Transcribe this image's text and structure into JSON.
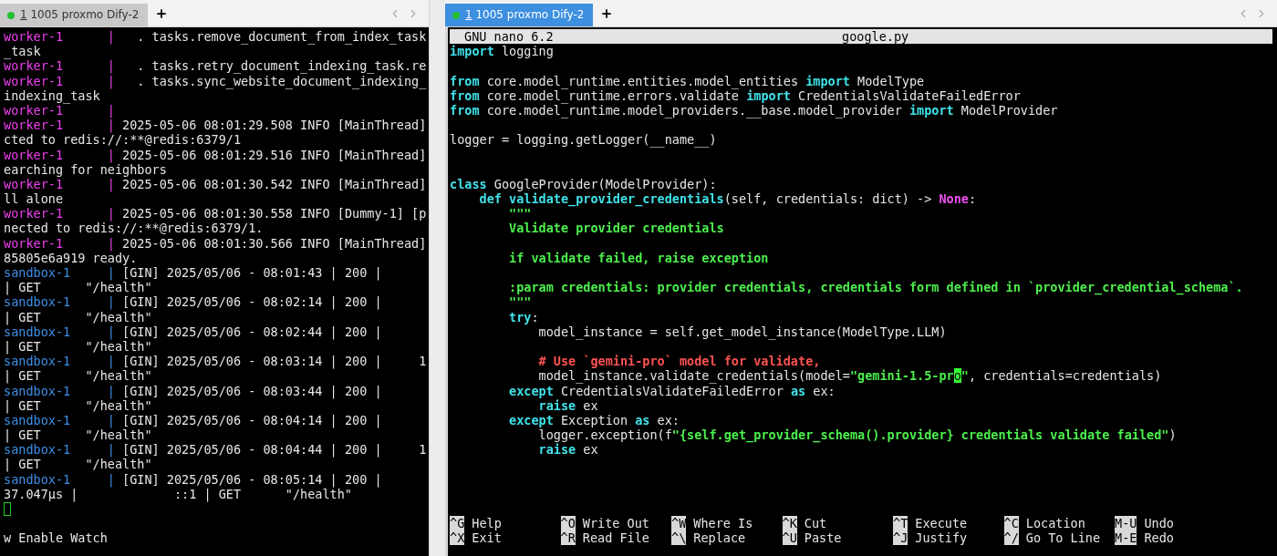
{
  "left_terminal": {
    "tab": {
      "index": "1",
      "label": "1005 proxmo Dify-2",
      "selected": false
    },
    "lines": [
      {
        "kind": "text",
        "segments": [
          {
            "kind": "worker",
            "text": "worker-1      |"
          },
          {
            "kind": "plain",
            "text": "   . tasks.remove_document_from_index_task"
          }
        ]
      },
      {
        "kind": "text",
        "segments": [
          {
            "kind": "plain",
            "text": "_task"
          }
        ]
      },
      {
        "kind": "text",
        "segments": [
          {
            "kind": "worker",
            "text": "worker-1      |"
          },
          {
            "kind": "plain",
            "text": "   . tasks.retry_document_indexing_task.re"
          }
        ]
      },
      {
        "kind": "text",
        "segments": [
          {
            "kind": "worker",
            "text": "worker-1      |"
          },
          {
            "kind": "plain",
            "text": "   . tasks.sync_website_document_indexing_"
          }
        ]
      },
      {
        "kind": "text",
        "segments": [
          {
            "kind": "plain",
            "text": "indexing_task"
          }
        ]
      },
      {
        "kind": "text",
        "segments": [
          {
            "kind": "worker",
            "text": "worker-1      |"
          }
        ]
      },
      {
        "kind": "text",
        "segments": [
          {
            "kind": "worker",
            "text": "worker-1      |"
          },
          {
            "kind": "plain",
            "text": " 2025-05-06 08:01:29.508 INFO [MainThread]"
          }
        ]
      },
      {
        "kind": "text",
        "segments": [
          {
            "kind": "plain",
            "text": "cted to redis://:**@redis:6379/1"
          }
        ]
      },
      {
        "kind": "text",
        "segments": [
          {
            "kind": "worker",
            "text": "worker-1      |"
          },
          {
            "kind": "plain",
            "text": " 2025-05-06 08:01:29.516 INFO [MainThread]"
          }
        ]
      },
      {
        "kind": "text",
        "segments": [
          {
            "kind": "plain",
            "text": "earching for neighbors"
          }
        ]
      },
      {
        "kind": "text",
        "segments": [
          {
            "kind": "worker",
            "text": "worker-1      |"
          },
          {
            "kind": "plain",
            "text": " 2025-05-06 08:01:30.542 INFO [MainThread]"
          }
        ]
      },
      {
        "kind": "text",
        "segments": [
          {
            "kind": "plain",
            "text": "ll alone"
          }
        ]
      },
      {
        "kind": "text",
        "segments": [
          {
            "kind": "worker",
            "text": "worker-1      |"
          },
          {
            "kind": "plain",
            "text": " 2025-05-06 08:01:30.558 INFO [Dummy-1] [p"
          }
        ]
      },
      {
        "kind": "text",
        "segments": [
          {
            "kind": "plain",
            "text": "nected to redis://:**@redis:6379/1."
          }
        ]
      },
      {
        "kind": "text",
        "segments": [
          {
            "kind": "worker",
            "text": "worker-1      |"
          },
          {
            "kind": "plain",
            "text": " 2025-05-06 08:01:30.566 INFO [MainThread]"
          }
        ]
      },
      {
        "kind": "text",
        "segments": [
          {
            "kind": "plain",
            "text": "85805e6a919 ready."
          }
        ]
      },
      {
        "kind": "text",
        "segments": [
          {
            "kind": "sandbox",
            "text": "sandbox-1     |"
          },
          {
            "kind": "plain",
            "text": " [GIN] 2025/05/06 - 08:01:43 | 200 |"
          }
        ]
      },
      {
        "kind": "text",
        "segments": [
          {
            "kind": "plain",
            "text": "| GET      \"/health\""
          }
        ]
      },
      {
        "kind": "text",
        "segments": [
          {
            "kind": "sandbox",
            "text": "sandbox-1     |"
          },
          {
            "kind": "plain",
            "text": " [GIN] 2025/05/06 - 08:02:14 | 200 |"
          }
        ]
      },
      {
        "kind": "text",
        "segments": [
          {
            "kind": "plain",
            "text": "| GET      \"/health\""
          }
        ]
      },
      {
        "kind": "text",
        "segments": [
          {
            "kind": "sandbox",
            "text": "sandbox-1     |"
          },
          {
            "kind": "plain",
            "text": " [GIN] 2025/05/06 - 08:02:44 | 200 |"
          }
        ]
      },
      {
        "kind": "text",
        "segments": [
          {
            "kind": "plain",
            "text": "| GET      \"/health\""
          }
        ]
      },
      {
        "kind": "text",
        "segments": [
          {
            "kind": "sandbox",
            "text": "sandbox-1     |"
          },
          {
            "kind": "plain",
            "text": " [GIN] 2025/05/06 - 08:03:14 | 200 |     1"
          }
        ]
      },
      {
        "kind": "text",
        "segments": [
          {
            "kind": "plain",
            "text": "| GET      \"/health\""
          }
        ]
      },
      {
        "kind": "text",
        "segments": [
          {
            "kind": "sandbox",
            "text": "sandbox-1     |"
          },
          {
            "kind": "plain",
            "text": " [GIN] 2025/05/06 - 08:03:44 | 200 |"
          }
        ]
      },
      {
        "kind": "text",
        "segments": [
          {
            "kind": "plain",
            "text": "| GET      \"/health\""
          }
        ]
      },
      {
        "kind": "text",
        "segments": [
          {
            "kind": "sandbox",
            "text": "sandbox-1     |"
          },
          {
            "kind": "plain",
            "text": " [GIN] 2025/05/06 - 08:04:14 | 200 |"
          }
        ]
      },
      {
        "kind": "text",
        "segments": [
          {
            "kind": "plain",
            "text": "| GET      \"/health\""
          }
        ]
      },
      {
        "kind": "text",
        "segments": [
          {
            "kind": "sandbox",
            "text": "sandbox-1     |"
          },
          {
            "kind": "plain",
            "text": " [GIN] 2025/05/06 - 08:04:44 | 200 |     1"
          }
        ]
      },
      {
        "kind": "text",
        "segments": [
          {
            "kind": "plain",
            "text": "| GET      \"/health\""
          }
        ]
      },
      {
        "kind": "text",
        "segments": [
          {
            "kind": "sandbox",
            "text": "sandbox-1     |"
          },
          {
            "kind": "plain",
            "text": " [GIN] 2025/05/06 - 08:05:14 | 200 |"
          }
        ]
      },
      {
        "kind": "text",
        "segments": [
          {
            "kind": "plain",
            "text": "37.047µs |             ::1 | GET      \"/health\""
          }
        ]
      },
      {
        "kind": "cursor"
      },
      {
        "kind": "blank"
      },
      {
        "kind": "text",
        "segments": [
          {
            "kind": "plain",
            "text": "w Enable Watch"
          }
        ]
      }
    ]
  },
  "right_terminal": {
    "tab": {
      "index": "1",
      "label": "1005 proxmo Dify-2",
      "selected": true
    },
    "nano_title": {
      "version": "GNU nano 6.2",
      "file": "google.py"
    },
    "code_lines": [
      {
        "kind": "text",
        "segments": [
          {
            "kind": "keyword",
            "text": "import"
          },
          {
            "kind": "plain",
            "text": " logging"
          }
        ]
      },
      {
        "kind": "blank"
      },
      {
        "kind": "text",
        "segments": [
          {
            "kind": "keyword",
            "text": "from"
          },
          {
            "kind": "plain",
            "text": " core.model_runtime.entities.model_entities "
          },
          {
            "kind": "keyword",
            "text": "import"
          },
          {
            "kind": "plain",
            "text": " ModelType"
          }
        ]
      },
      {
        "kind": "text",
        "segments": [
          {
            "kind": "keyword",
            "text": "from"
          },
          {
            "kind": "plain",
            "text": " core.model_runtime.errors.validate "
          },
          {
            "kind": "keyword",
            "text": "import"
          },
          {
            "kind": "plain",
            "text": " CredentialsValidateFailedError"
          }
        ]
      },
      {
        "kind": "text",
        "segments": [
          {
            "kind": "keyword",
            "text": "from"
          },
          {
            "kind": "plain",
            "text": " core.model_runtime.model_providers.__base.model_provider "
          },
          {
            "kind": "keyword",
            "text": "import"
          },
          {
            "kind": "plain",
            "text": " ModelProvider"
          }
        ]
      },
      {
        "kind": "blank"
      },
      {
        "kind": "text",
        "segments": [
          {
            "kind": "plain",
            "text": "logger = logging.getLogger(__name__)"
          }
        ]
      },
      {
        "kind": "blank"
      },
      {
        "kind": "blank"
      },
      {
        "kind": "text",
        "segments": [
          {
            "kind": "keyword",
            "text": "class"
          },
          {
            "kind": "plain",
            "text": " GoogleProvider(ModelProvider):"
          }
        ]
      },
      {
        "kind": "text",
        "segments": [
          {
            "kind": "keyword",
            "text": "    def validate_provider_credentials"
          },
          {
            "kind": "plain",
            "text": "(self, credentials: dict) -> "
          },
          {
            "kind": "constant",
            "text": "None"
          },
          {
            "kind": "plain",
            "text": ":"
          }
        ]
      },
      {
        "kind": "text",
        "segments": [
          {
            "kind": "string",
            "text": "        \"\"\""
          }
        ]
      },
      {
        "kind": "text",
        "segments": [
          {
            "kind": "string",
            "text": "        Validate provider credentials"
          }
        ]
      },
      {
        "kind": "blank"
      },
      {
        "kind": "text",
        "segments": [
          {
            "kind": "string",
            "text": "        if validate failed, raise exception"
          }
        ]
      },
      {
        "kind": "blank"
      },
      {
        "kind": "text",
        "segments": [
          {
            "kind": "string",
            "text": "        :param credentials: provider credentials, credentials form defined in `provider_credential_schema`."
          }
        ]
      },
      {
        "kind": "text",
        "segments": [
          {
            "kind": "string",
            "text": "        \"\"\""
          }
        ]
      },
      {
        "kind": "text",
        "segments": [
          {
            "kind": "keyword",
            "text": "        try"
          },
          {
            "kind": "plain",
            "text": ":"
          }
        ]
      },
      {
        "kind": "text",
        "segments": [
          {
            "kind": "plain",
            "text": "            model_instance = self.get_model_instance(ModelType.LLM)"
          }
        ]
      },
      {
        "kind": "blank"
      },
      {
        "kind": "text",
        "segments": [
          {
            "kind": "comment",
            "text": "            # Use `gemini-pro` model for validate,"
          }
        ]
      },
      {
        "kind": "text",
        "segments": [
          {
            "kind": "plain",
            "text": "            model_instance.validate_credentials(model="
          },
          {
            "kind": "string",
            "text": "\"gemini-1.5-pr"
          },
          {
            "kind": "cursor",
            "text": "o"
          },
          {
            "kind": "string",
            "text": "\""
          },
          {
            "kind": "plain",
            "text": ", credentials=credentials)"
          }
        ]
      },
      {
        "kind": "text",
        "segments": [
          {
            "kind": "keyword",
            "text": "        except"
          },
          {
            "kind": "plain",
            "text": " CredentialsValidateFailedError "
          },
          {
            "kind": "keyword",
            "text": "as"
          },
          {
            "kind": "plain",
            "text": " ex:"
          }
        ]
      },
      {
        "kind": "text",
        "segments": [
          {
            "kind": "keyword",
            "text": "            raise"
          },
          {
            "kind": "plain",
            "text": " ex"
          }
        ]
      },
      {
        "kind": "text",
        "segments": [
          {
            "kind": "keyword",
            "text": "        except"
          },
          {
            "kind": "plain",
            "text": " Exception "
          },
          {
            "kind": "keyword",
            "text": "as"
          },
          {
            "kind": "plain",
            "text": " ex:"
          }
        ]
      },
      {
        "kind": "text",
        "segments": [
          {
            "kind": "plain",
            "text": "            logger.exception(f"
          },
          {
            "kind": "string",
            "text": "\"{self.get_provider_schema().provider} credentials validate failed\""
          },
          {
            "kind": "plain",
            "text": ")"
          }
        ]
      },
      {
        "kind": "text",
        "segments": [
          {
            "kind": "keyword",
            "text": "            raise"
          },
          {
            "kind": "plain",
            "text": " ex"
          }
        ]
      }
    ],
    "shortcuts": [
      {
        "key": "^G",
        "label": "Help"
      },
      {
        "key": "^O",
        "label": "Write Out"
      },
      {
        "key": "^W",
        "label": "Where Is"
      },
      {
        "key": "^K",
        "label": "Cut"
      },
      {
        "key": "^T",
        "label": "Execute"
      },
      {
        "key": "^C",
        "label": "Location"
      },
      {
        "key": "M-U",
        "label": "Undo"
      },
      {
        "key": "^X",
        "label": "Exit"
      },
      {
        "key": "^R",
        "label": "Read File"
      },
      {
        "key": "^\\",
        "label": "Replace"
      },
      {
        "key": "^U",
        "label": "Paste"
      },
      {
        "key": "^J",
        "label": "Justify"
      },
      {
        "key": "^/",
        "label": "Go To Line"
      },
      {
        "key": "M-E",
        "label": "Redo"
      }
    ]
  }
}
